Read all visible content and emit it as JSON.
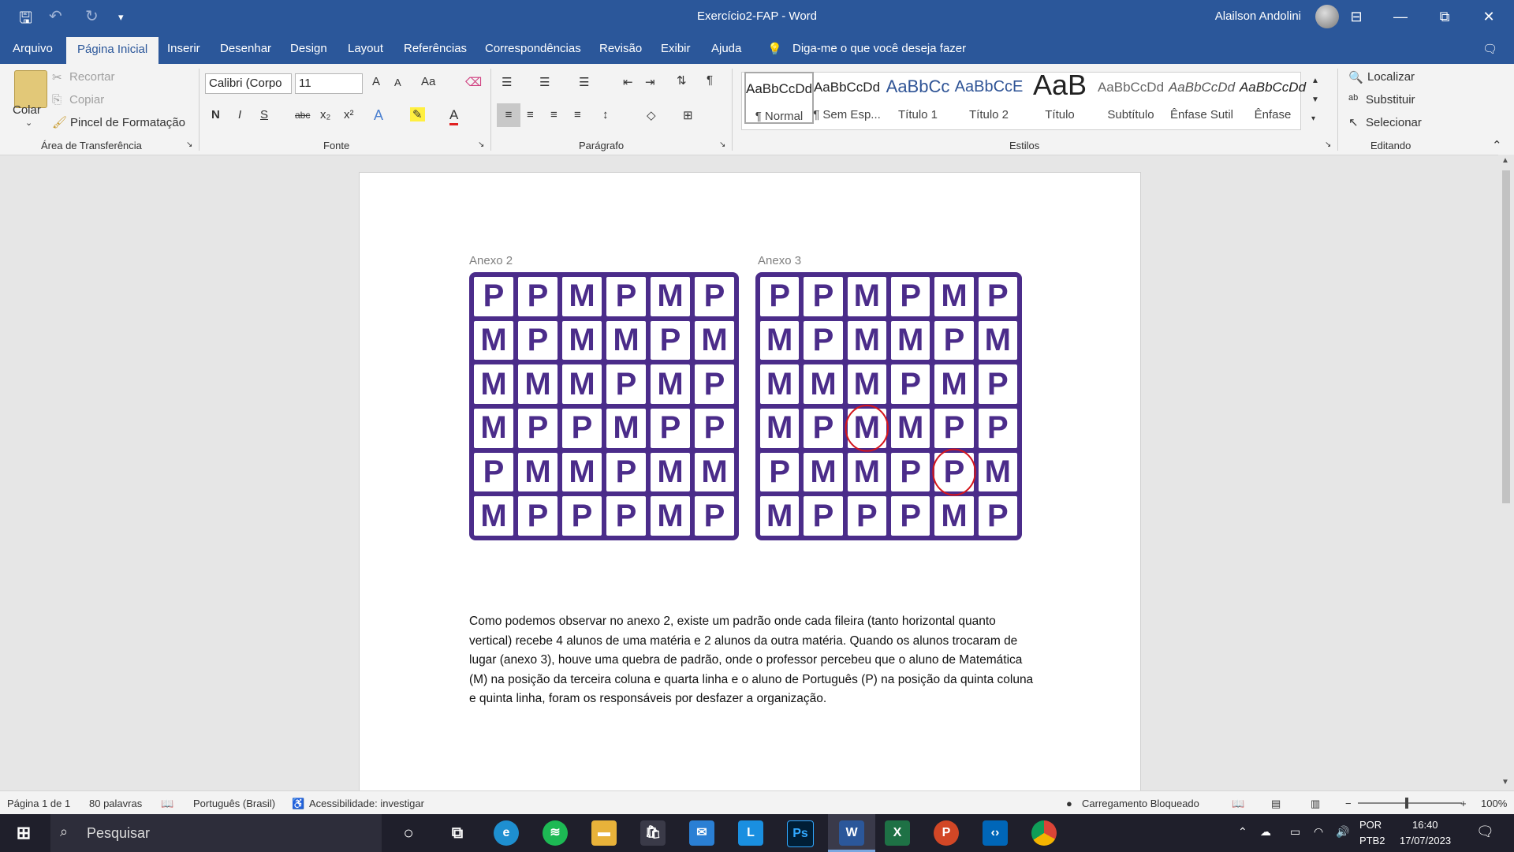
{
  "window": {
    "title": "Exercício2-FAP  -  Word",
    "user_name": "Alailson Andolini",
    "controls": [
      "⊟",
      "—",
      "⧉",
      "✕"
    ]
  },
  "quick_access": [
    "save-icon",
    "undo-icon",
    "redo-icon",
    "customize-icon"
  ],
  "tabs": [
    "Arquivo",
    "Página Inicial",
    "Inserir",
    "Desenhar",
    "Design",
    "Layout",
    "Referências",
    "Correspondências",
    "Revisão",
    "Exibir",
    "Ajuda"
  ],
  "active_tab": "Página Inicial",
  "tell_me": "Diga-me o que você deseja fazer",
  "ribbon": {
    "clipboard": {
      "paste_label": "Colar",
      "cut_label": "Recortar",
      "copy_label": "Copiar",
      "format_painter_label": "Pincel de Formatação",
      "group_label": "Área de Transferência"
    },
    "font": {
      "font_name": "Calibri (Corpo",
      "font_size": "11",
      "bold": "N",
      "italic": "I",
      "underline": "S",
      "strike": "abc",
      "subscript": "x₂",
      "superscript": "x²",
      "change_case": "Aa",
      "grow": "A",
      "shrink": "A",
      "group_label": "Fonte"
    },
    "paragraph": {
      "group_label": "Parágrafo"
    },
    "styles": {
      "items": [
        {
          "preview": "AaBbCcDd",
          "name": "¶ Normal"
        },
        {
          "preview": "AaBbCcDd",
          "name": "¶ Sem Esp..."
        },
        {
          "preview": "AaBbCc",
          "name": "Título 1"
        },
        {
          "preview": "AaBbCcE",
          "name": "Título 2"
        },
        {
          "preview": "AaB",
          "name": "Título"
        },
        {
          "preview": "AaBbCcDd",
          "name": "Subtítulo"
        },
        {
          "preview": "AaBbCcDd",
          "name": "Ênfase Sutil"
        },
        {
          "preview": "AaBbCcDd",
          "name": "Ênfase"
        }
      ],
      "group_label": "Estilos"
    },
    "editing": {
      "find_label": "Localizar",
      "replace_label": "Substituir",
      "select_label": "Selecionar",
      "group_label": "Editando"
    }
  },
  "document": {
    "annex2_label": "Anexo 2",
    "annex3_label": "Anexo 3",
    "annex2": [
      [
        "P",
        "P",
        "M",
        "P",
        "M",
        "P"
      ],
      [
        "M",
        "P",
        "M",
        "M",
        "P",
        "M"
      ],
      [
        "M",
        "M",
        "M",
        "P",
        "M",
        "P"
      ],
      [
        "M",
        "P",
        "P",
        "M",
        "P",
        "P"
      ],
      [
        "P",
        "M",
        "M",
        "P",
        "M",
        "M"
      ],
      [
        "M",
        "P",
        "P",
        "P",
        "M",
        "P"
      ]
    ],
    "annex3": [
      [
        "P",
        "P",
        "M",
        "P",
        "M",
        "P"
      ],
      [
        "M",
        "P",
        "M",
        "M",
        "P",
        "M"
      ],
      [
        "M",
        "M",
        "M",
        "P",
        "M",
        "P"
      ],
      [
        "M",
        "P",
        "M",
        "M",
        "P",
        "P"
      ],
      [
        "P",
        "M",
        "M",
        "P",
        "P",
        "M"
      ],
      [
        "M",
        "P",
        "P",
        "P",
        "M",
        "P"
      ]
    ],
    "circled_cells": [
      [
        3,
        2
      ],
      [
        4,
        4
      ]
    ],
    "grid_color": "#4b2c8a",
    "circle_color": "#d4151c",
    "paragraph": "Como podemos observar no anexo 2, existe um padrão onde cada fileira (tanto horizontal quanto vertical) recebe 4 alunos de uma matéria e 2 alunos da outra matéria. Quando os alunos trocaram de lugar (anexo 3), houve uma quebra de padrão, onde o professor percebeu que o aluno de Matemática (M) na posição da terceira coluna e quarta linha e o aluno de Português (P) na posição da quinta coluna e quinta linha, foram os responsáveis por desfazer a organização."
  },
  "status": {
    "page": "Página 1 de 1",
    "words": "80 palavras",
    "language": "Português (Brasil)",
    "accessibility": "Acessibilidade: investigar",
    "loading": "Carregamento Bloqueado",
    "zoom": "100%"
  },
  "taskbar": {
    "search_placeholder": "Pesquisar",
    "language": "POR",
    "keyboard": "PTB2",
    "time": "16:40",
    "date": "17/07/2023"
  }
}
